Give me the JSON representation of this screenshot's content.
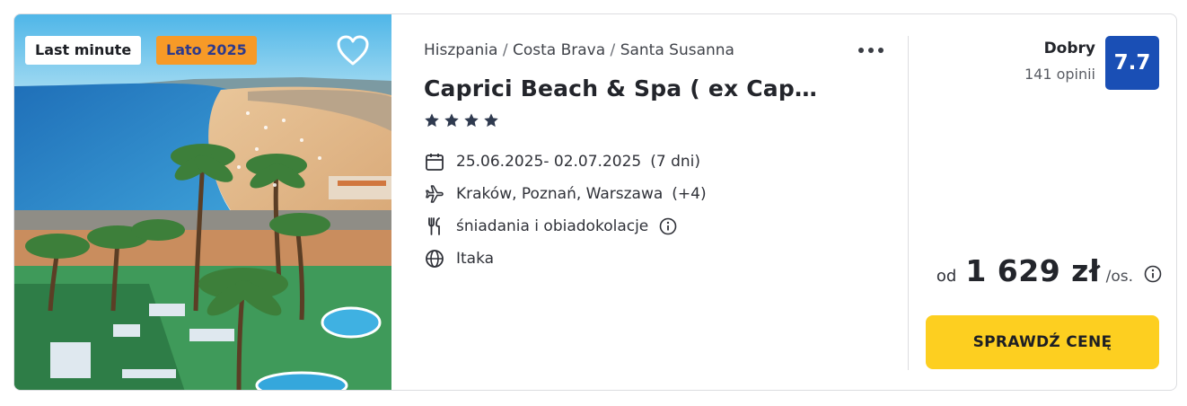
{
  "photo": {
    "alt_icon": "hotel-beach-photo",
    "badges": [
      "Last minute",
      "Lato 2025"
    ],
    "favorite_icon": "heart-outline-icon"
  },
  "breadcrumb": {
    "country": "Hiszpania",
    "region": "Costa Brava",
    "city": "Santa Susanna",
    "separator": "/"
  },
  "hotel": {
    "name": "Caprici Beach & Spa ( ex Capri…",
    "stars": 4
  },
  "details": {
    "dates": "25.06.2025- 02.07.2025",
    "duration": "(7 dni)",
    "departure": "Kraków, Poznań, Warszawa",
    "departure_extra": "(+4)",
    "board": "śniadania i obiadokolacje",
    "operator": "Itaka"
  },
  "rating": {
    "label": "Dobry",
    "count": "141 opinii",
    "score": "7.7"
  },
  "price": {
    "prefix": "od",
    "value": "1 629 zł",
    "unit": "/os."
  },
  "cta": {
    "label": "SPRAWDŹ CENĘ"
  },
  "colors": {
    "badge_season_bg": "#f79a27",
    "rating_bg": "#1a4fb5",
    "cta_bg": "#fdcf20"
  }
}
